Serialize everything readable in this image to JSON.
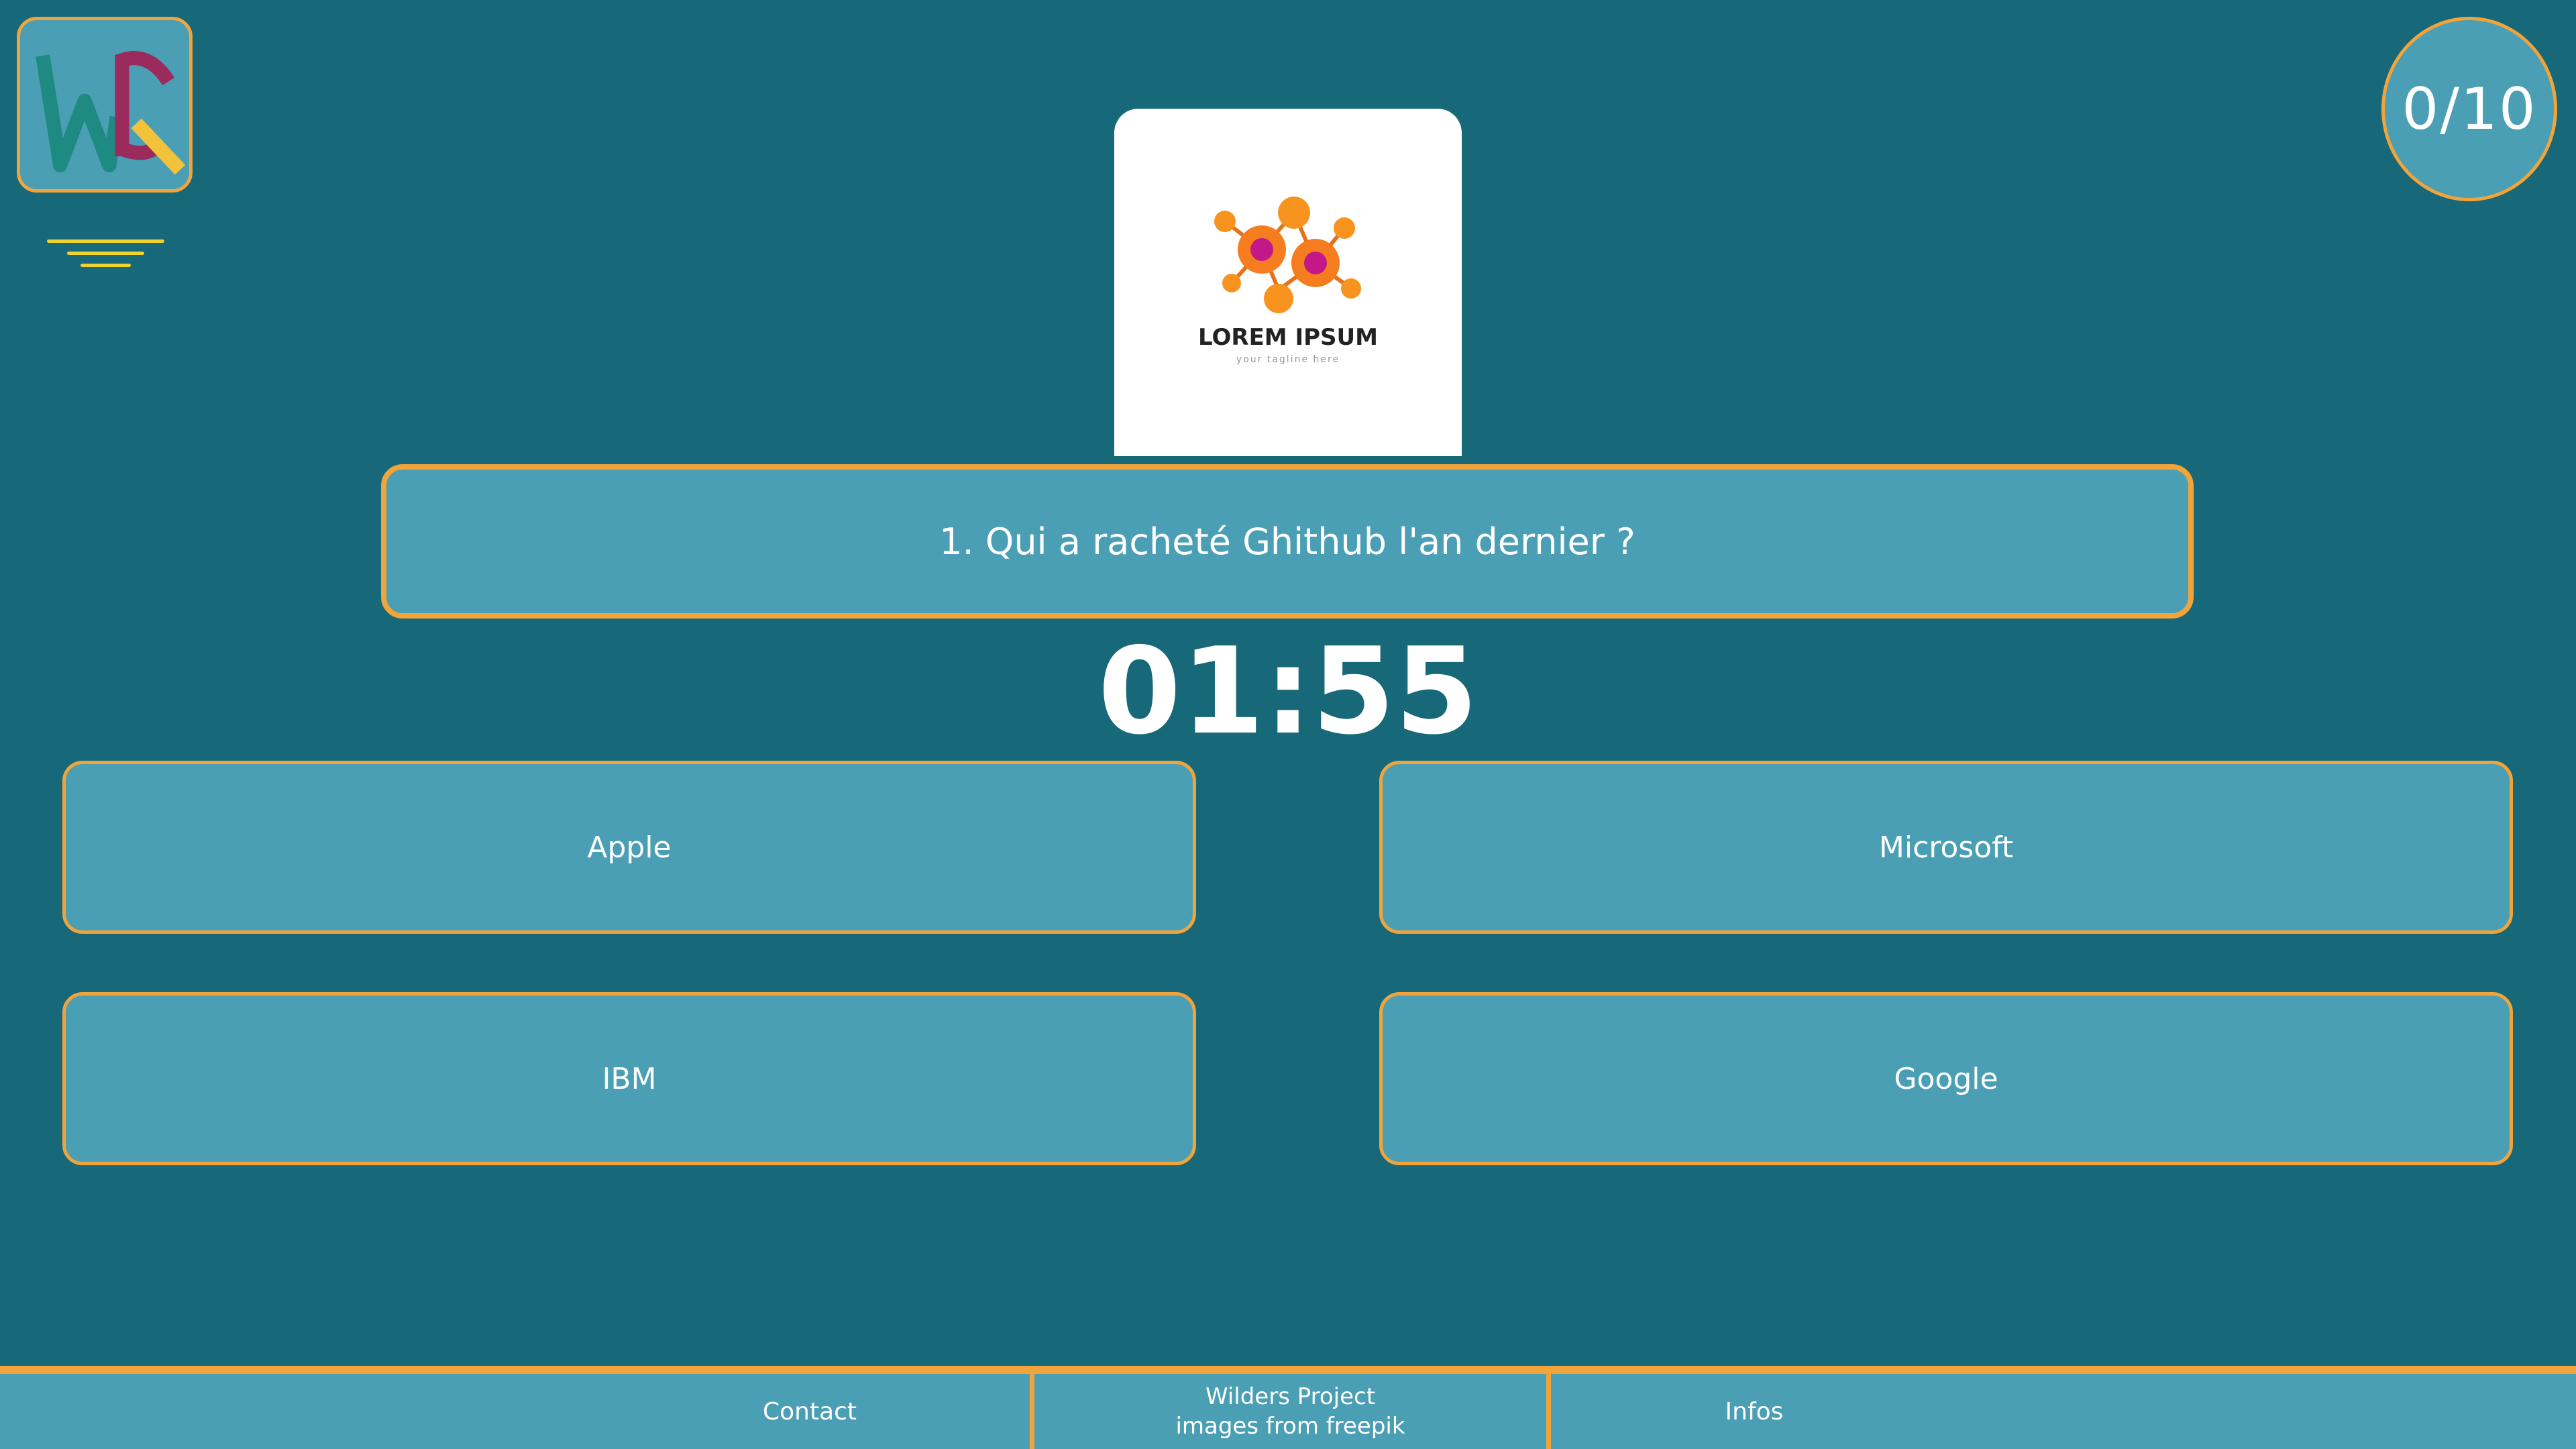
{
  "app": {
    "logo_letters": "WQ"
  },
  "score": {
    "text": "0/10"
  },
  "quiz_image": {
    "brand": "LOREM IPSUM",
    "tagline": "your tagline here"
  },
  "question": {
    "text": "1. Qui a racheté Ghithub l'an dernier ?"
  },
  "timer": {
    "text": "01:55"
  },
  "answers": [
    {
      "label": "Apple"
    },
    {
      "label": "Microsoft"
    },
    {
      "label": "IBM"
    },
    {
      "label": "Google"
    }
  ],
  "footer": {
    "contact": "Contact",
    "project": "Wilders Project",
    "credits": "images from freepik",
    "infos": "Infos"
  },
  "icons": {
    "menu": "hamburger-menu-icon",
    "logo": "wq-logo-icon"
  },
  "colors": {
    "background": "#176878",
    "panel": "#4a9fb5",
    "border": "#f2a43a",
    "menu_lines": "#f2d22e"
  }
}
